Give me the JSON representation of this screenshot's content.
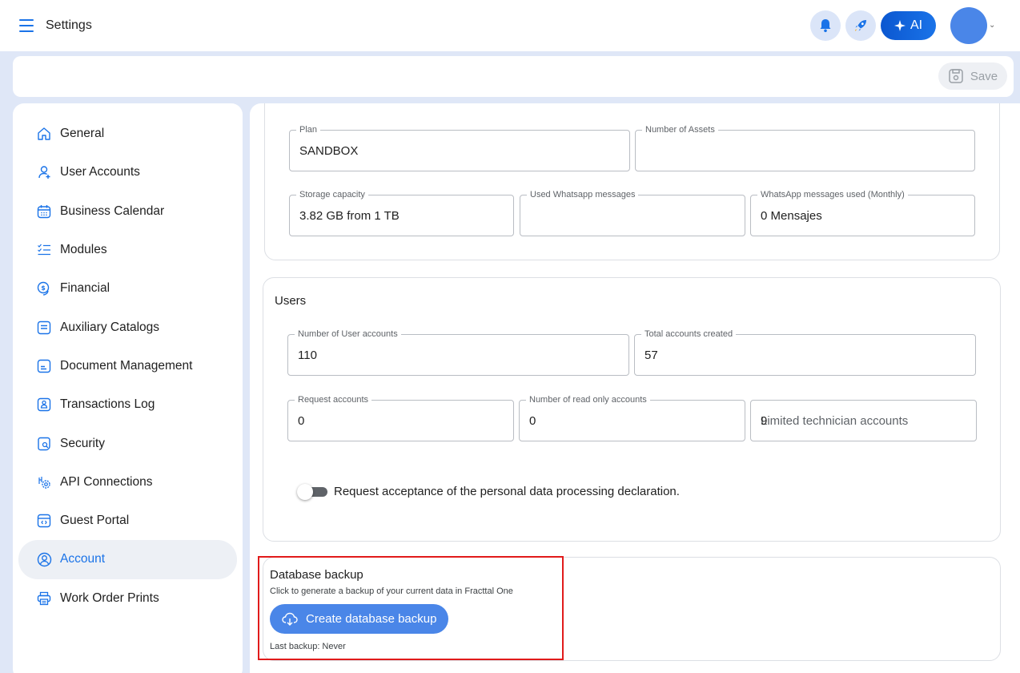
{
  "header": {
    "title": "Settings",
    "ai_label": "AI",
    "accent": "#1a73e8",
    "icons": [
      "menu-icon",
      "bell-icon",
      "rocket-icon",
      "sparkle-icon",
      "avatar",
      "chevron-down-icon"
    ]
  },
  "toolbar": {
    "save_label": "Save"
  },
  "sidebar": {
    "items": [
      {
        "label": "General",
        "icon": "home-icon"
      },
      {
        "label": "User Accounts",
        "icon": "user-add-icon"
      },
      {
        "label": "Business Calendar",
        "icon": "calendar-icon"
      },
      {
        "label": "Modules",
        "icon": "checklist-icon"
      },
      {
        "label": "Financial",
        "icon": "dollar-coin-icon"
      },
      {
        "label": "Auxiliary Catalogs",
        "icon": "catalog-icon"
      },
      {
        "label": "Document Management",
        "icon": "document-icon"
      },
      {
        "label": "Transactions Log",
        "icon": "log-icon"
      },
      {
        "label": "Security",
        "icon": "shield-search-icon"
      },
      {
        "label": "API Connections",
        "icon": "api-gear-icon"
      },
      {
        "label": "Guest Portal",
        "icon": "portal-icon"
      },
      {
        "label": "Account",
        "icon": "account-circle-icon",
        "active": true
      },
      {
        "label": "Work Order Prints",
        "icon": "printer-icon"
      }
    ]
  },
  "plan_section": {
    "plan": {
      "label": "Plan",
      "value": "SANDBOX"
    },
    "assets": {
      "label": "Number of Assets",
      "value": ""
    },
    "storage": {
      "label": "Storage capacity",
      "value": "3.82 GB from 1 TB"
    },
    "used_whatsapp": {
      "label": "Used Whatsapp messages",
      "value": ""
    },
    "whatsapp_monthly": {
      "label": "WhatsApp messages used (Monthly)",
      "value": "0 Mensajes"
    }
  },
  "users_section": {
    "title": "Users",
    "user_accounts": {
      "label": "Number of User accounts",
      "value": "110"
    },
    "total_created": {
      "label": "Total accounts created",
      "value": "57"
    },
    "request_accounts": {
      "label": "Request accounts",
      "value": "0"
    },
    "read_only": {
      "label": "Number of read only accounts",
      "value": "0"
    },
    "limited_tech": {
      "value": "9",
      "placeholder": "Limited technician accounts"
    },
    "toggle_label": "Request acceptance of the personal data processing declaration.",
    "toggle_on": false
  },
  "backup_section": {
    "title": "Database backup",
    "description": "Click to generate a backup of your current data in Fracttal One",
    "button_label": "Create database backup",
    "last_backup": "Last backup: Never"
  }
}
